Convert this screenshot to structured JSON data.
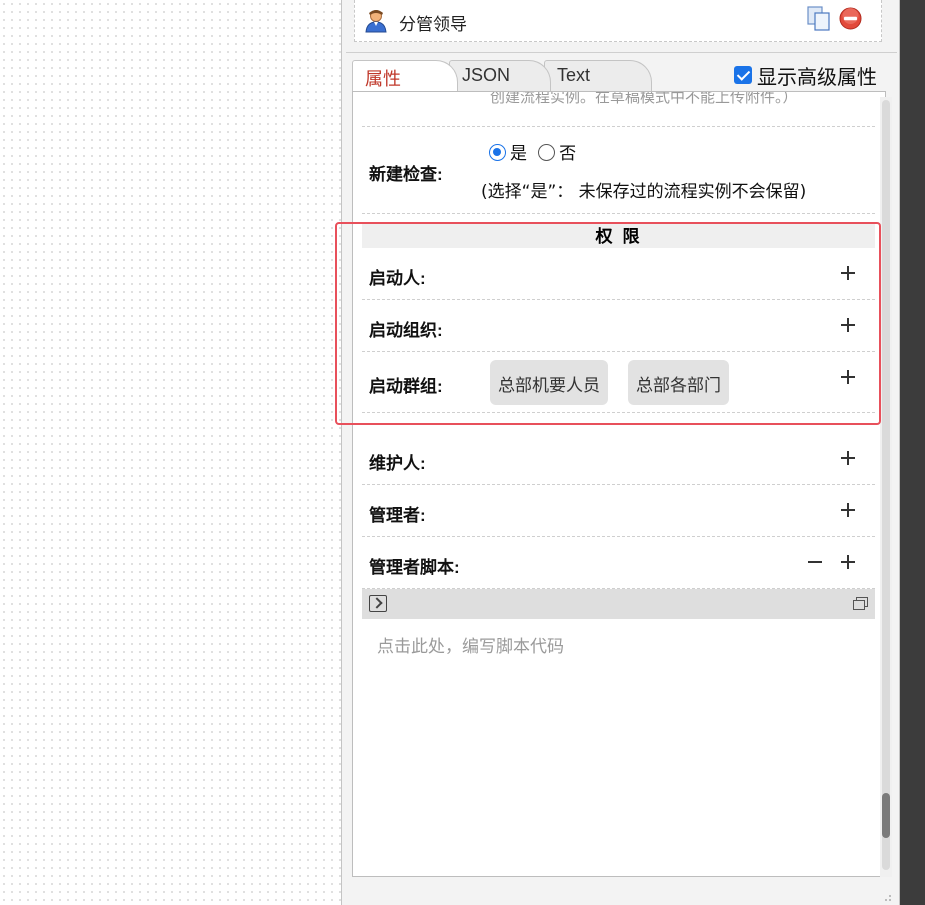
{
  "role": {
    "name": "分管领导"
  },
  "tabs": [
    {
      "label": "属性"
    },
    {
      "label": "JSON"
    },
    {
      "label": "Text"
    }
  ],
  "advanced": {
    "label": "显示高级属性",
    "checked": true
  },
  "cut_text": "创建流程实例。在草稿模式中不能上传附件。）",
  "new_check": {
    "label": "新建检查:",
    "option_yes": "是",
    "option_no": "否",
    "selected": "是",
    "note": "(选择“是”：  未保存过的流程实例不会保留)"
  },
  "permissions": {
    "title": "权 限",
    "starter_label": "启动人:",
    "starter_org_label": "启动组织:",
    "starter_group_label": "启动群组:",
    "groups": [
      "总部机要人员",
      "总部各部门"
    ]
  },
  "maintainer_label": "维护人:",
  "manager_label": "管理者:",
  "manager_script_label": "管理者脚本:",
  "script_placeholder": "点击此处，编写脚本代码",
  "icons": {
    "user": "user-icon",
    "copy": "copy-icon",
    "remove": "remove-icon",
    "add": "plus-icon",
    "collapse": "minus-icon",
    "terminal": "terminal-icon",
    "maximize": "maximize-icon"
  },
  "colors": {
    "accent": "#1a73e8",
    "active_tab": "#c0392b",
    "highlight": "#e8505b"
  }
}
